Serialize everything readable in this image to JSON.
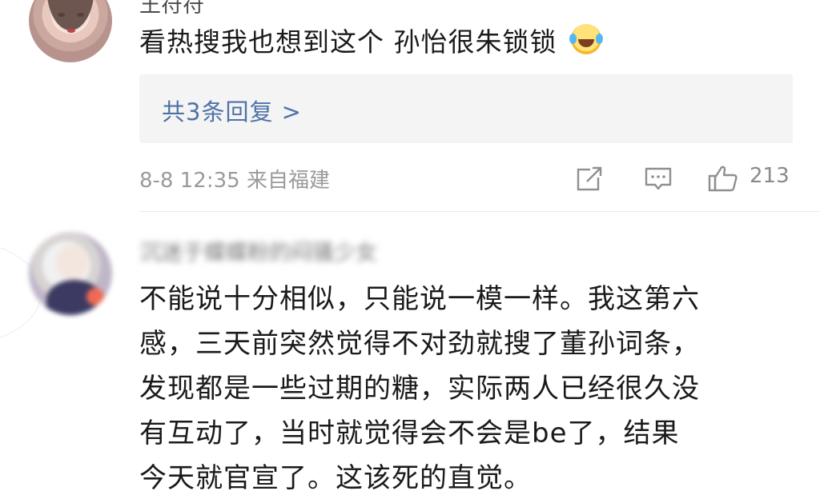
{
  "comment1": {
    "username": "王符符",
    "text": "看热搜我也想到这个 孙怡很朱锁锁",
    "emoji": "laughing-crying-emoji",
    "replies_link": "共3条回复 >",
    "date": "8-8 12:35",
    "location": "来自福建",
    "like_count": "213"
  },
  "comment2": {
    "username": "沉迷于蝶蝶粉的闷骚少女",
    "lines": [
      "不能说十分相似，只能说一模一样。我这第六",
      "感，三天前突然觉得不对劲就搜了董孙词条，",
      "发现都是一些过期的糖，实际两人已经很久没",
      "有互动了，当时就觉得会不会是be了，结果",
      "今天就官宣了。这该死的直觉。"
    ]
  },
  "colors": {
    "link": "#4e72a8",
    "meta": "#9a9a9a",
    "text": "#1a1a1a",
    "reply_bg": "#f4f4f4"
  },
  "icons": [
    "share-icon",
    "comment-icon",
    "thumbs-up-icon"
  ]
}
